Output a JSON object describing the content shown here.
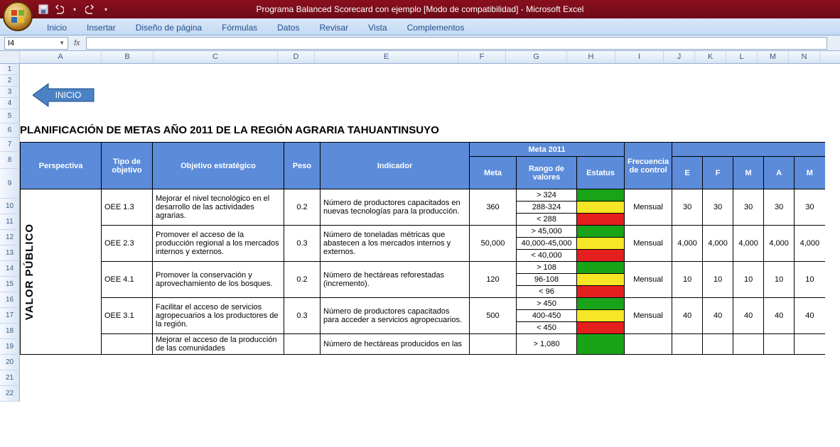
{
  "window": {
    "title_doc": "Programa Balanced Scorecard con ejemplo  [Modo de compatibilidad]",
    "title_app": " - Microsoft Excel"
  },
  "ribbon": {
    "tabs": [
      "Inicio",
      "Insertar",
      "Diseño de página",
      "Fórmulas",
      "Datos",
      "Revisar",
      "Vista",
      "Complementos"
    ]
  },
  "namebox": "I4",
  "fx_label": "fx",
  "columns": [
    "A",
    "B",
    "C",
    "D",
    "E",
    "F",
    "G",
    "H",
    "I",
    "J",
    "K",
    "L",
    "M",
    "N"
  ],
  "row_numbers": [
    1,
    2,
    3,
    4,
    5,
    6,
    7,
    8,
    9,
    10,
    11,
    12,
    13,
    14,
    15,
    16,
    17,
    18,
    19,
    20,
    21,
    22
  ],
  "inicio_btn": "INICIO",
  "plan_title": "PLANIFICACIÓN DE METAS AÑO 2011 DE LA REGIÓN AGRARIA TAHUANTINSUYO",
  "headers": {
    "perspectiva": "Perspectiva",
    "tipo": "Tipo de objetivo",
    "objetivo": "Objetivo estratégico",
    "peso": "Peso",
    "indicador": "Indicador",
    "meta2011": "Meta 2011",
    "meta": "Meta",
    "rango": "Rango de valores",
    "estatus": "Estatus",
    "frecuencia": "Frecuencia de control",
    "months": [
      "E",
      "F",
      "M",
      "A",
      "M"
    ]
  },
  "perspectiva_label": "VALOR PÚBLICO",
  "rows": [
    {
      "tipo": "OEE 1.3",
      "obj": "Mejorar el nivel tecnológico en el desarrollo de las actividades agrarias.",
      "peso": "0.2",
      "indicador": "Número de productores capacitados en nuevas tecnologías para la producción.",
      "meta": "360",
      "rangos": [
        "> 324",
        "288-324",
        "< 288"
      ],
      "freq": "Mensual",
      "vals": [
        "30",
        "30",
        "30",
        "30",
        "30"
      ]
    },
    {
      "tipo": "OEE 2.3",
      "obj": "Promover el acceso de la producción regional a los mercados internos y externos.",
      "peso": "0.3",
      "indicador": "Número de toneladas métricas que abastecen a los mercados internos y externos.",
      "meta": "50,000",
      "rangos": [
        "> 45,000",
        "40,000-45,000",
        "< 40,000"
      ],
      "freq": "Mensual",
      "vals": [
        "4,000",
        "4,000",
        "4,000",
        "4,000",
        "4,000"
      ]
    },
    {
      "tipo": "OEE 4.1",
      "obj": "Promover la conservación y aprovechamiento de los bosques.",
      "peso": "0.2",
      "indicador": "Número de hectáreas reforestadas (incremento).",
      "meta": "120",
      "rangos": [
        "> 108",
        "96-108",
        "< 96"
      ],
      "freq": "Mensual",
      "vals": [
        "10",
        "10",
        "10",
        "10",
        "10"
      ]
    },
    {
      "tipo": "OEE 3.1",
      "obj": "Facilitar el acceso de servicios agropecuarios a los productores de la región.",
      "peso": "0.3",
      "indicador": "Número de productores capacitados para acceder a servicios agropecuarios.",
      "meta": "500",
      "rangos": [
        "> 450",
        "400-450",
        "< 450"
      ],
      "freq": "Mensual",
      "vals": [
        "40",
        "40",
        "40",
        "40",
        "40"
      ]
    },
    {
      "tipo": "",
      "obj": "Mejorar el acceso de la producción de las comunidades",
      "peso": "",
      "indicador": "Número de hectáreas producidos en las",
      "meta": "",
      "rangos": [
        "> 1,080",
        "",
        ""
      ],
      "freq": "",
      "vals": [
        "",
        "",
        "",
        "",
        ""
      ]
    }
  ]
}
